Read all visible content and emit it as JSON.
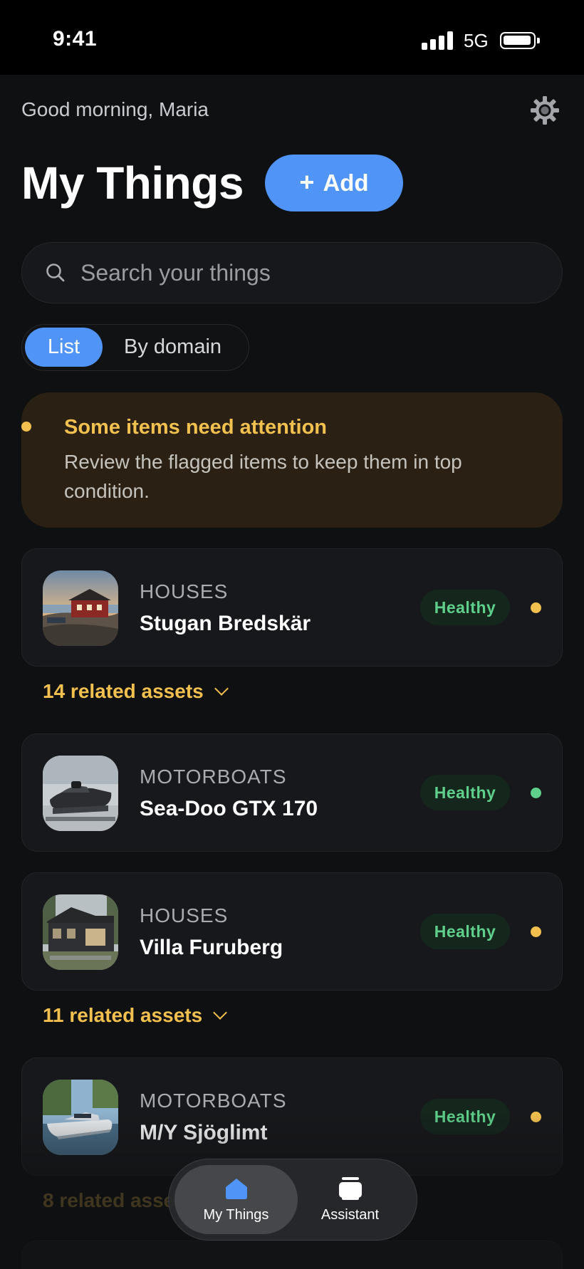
{
  "status_bar": {
    "time": "9:41",
    "network": "5G"
  },
  "header": {
    "greeting": "Good morning, Maria",
    "title": "My Things",
    "add_label": "Add"
  },
  "search": {
    "placeholder": "Search your things"
  },
  "view_toggle": {
    "options": [
      "List",
      "By domain"
    ],
    "selected": "List"
  },
  "alert": {
    "title": "Some items need attention",
    "body": "Review the flagged items to keep them in top condition."
  },
  "items": [
    {
      "domain": "HOUSES",
      "name": "Stugan Bredskär",
      "badge": "Healthy",
      "dot_color": "#f2c04e",
      "related": "14 related assets"
    },
    {
      "domain": "MOTORBOATS",
      "name": "Sea-Doo GTX 170",
      "badge": "Healthy",
      "dot_color": "#5fd08b",
      "related": ""
    },
    {
      "domain": "HOUSES",
      "name": "Villa Furuberg",
      "badge": "Healthy",
      "dot_color": "#f2c04e",
      "related": "11 related assets"
    },
    {
      "domain": "MOTORBOATS",
      "name": "M/Y Sjöglimt",
      "badge": "Healthy",
      "dot_color": "#f2c04e",
      "related": "8 related assets"
    }
  ],
  "tabbar": {
    "tabs": [
      {
        "label": "My Things",
        "icon": "house-icon",
        "active": true
      },
      {
        "label": "Assistant",
        "icon": "assistant-icon",
        "active": false
      }
    ]
  },
  "colors": {
    "accent": "#4f94f6",
    "warning": "#f2c04e",
    "healthy": "#5fd08b",
    "background": "#0f1012"
  }
}
